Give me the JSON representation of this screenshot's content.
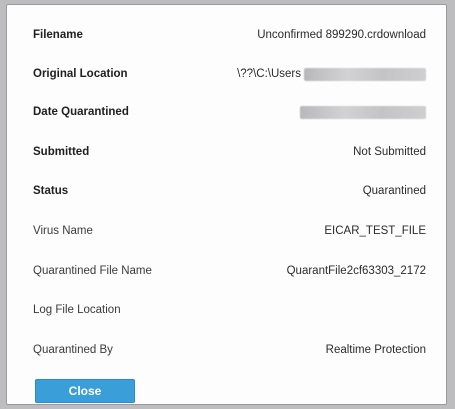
{
  "details": {
    "filename": {
      "label": "Filename",
      "value": "Unconfirmed 899290.crdownload"
    },
    "original_location": {
      "label": "Original Location",
      "value": "\\??\\C:\\Users"
    },
    "date_quarantined": {
      "label": "Date Quarantined",
      "value": ""
    },
    "submitted": {
      "label": "Submitted",
      "value": "Not Submitted"
    },
    "status": {
      "label": "Status",
      "value": "Quarantined"
    },
    "virus_name": {
      "label": "Virus Name",
      "value": "EICAR_TEST_FILE"
    },
    "quarantined_file_name": {
      "label": "Quarantined File Name",
      "value": "QuarantFile2cf63303_2172"
    },
    "log_file_location": {
      "label": "Log File Location",
      "value": ""
    },
    "quarantined_by": {
      "label": "Quarantined By",
      "value": "Realtime Protection"
    }
  },
  "buttons": {
    "close_label": "Close"
  },
  "colors": {
    "button_accent": "#3a9fd8"
  }
}
